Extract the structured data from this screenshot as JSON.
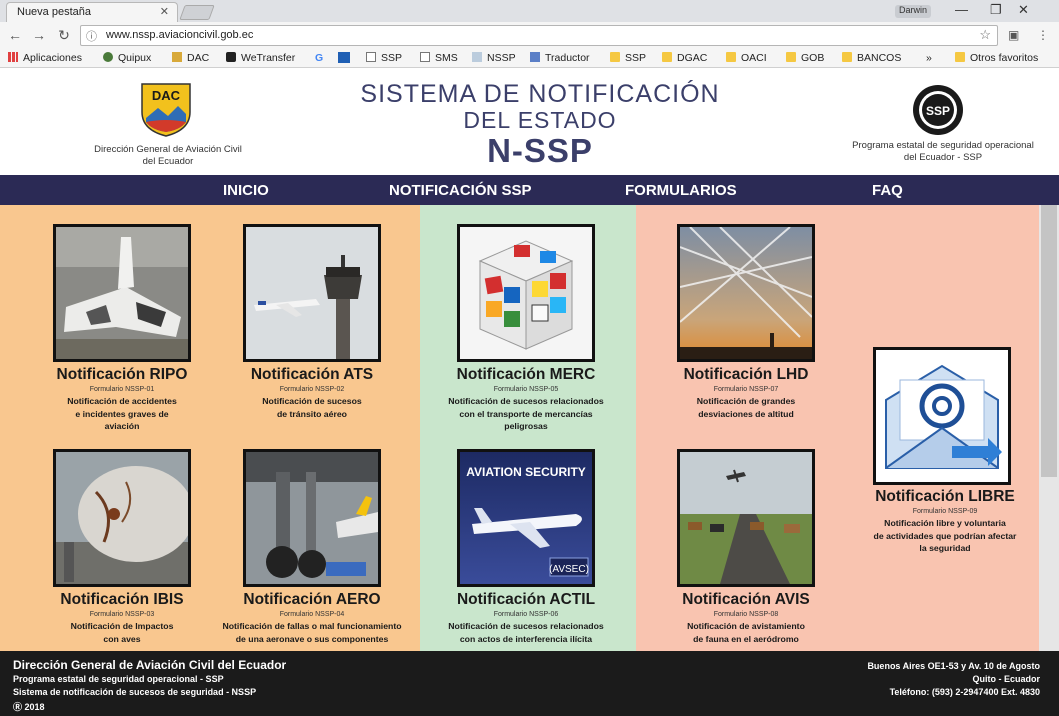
{
  "browser": {
    "tab_title": "Nueva pestaña",
    "user_name": "Darwin",
    "url": "www.nssp.aviacioncivil.gob.ec",
    "bookmarks": [
      "Aplicaciones",
      "Quipux",
      "DAC",
      "WeTransfer",
      "G",
      "SSP",
      "SMS",
      "NSSP",
      "Traductor",
      "SSP",
      "DGAC",
      "OACI",
      "GOB",
      "BANCOS"
    ],
    "overflow": "»",
    "other_bookmarks": "Otros favoritos"
  },
  "header": {
    "dac_logo_text": "DAC",
    "dac_caption_line1": "Dirección General de Aviación Civil",
    "dac_caption_line2": "del Ecuador",
    "title_line1": "SISTEMA DE NOTIFICACIÓN",
    "title_line2": "DEL ESTADO",
    "title_line3": "N-SSP",
    "ssp_logo_text": "SSP",
    "ssp_caption_line1": "Programa estatal de seguridad operacional",
    "ssp_caption_line2": "del Ecuador - SSP"
  },
  "nav": {
    "items": [
      "INICIO",
      "NOTIFICACIÓN SSP",
      "FORMULARIOS",
      "FAQ"
    ]
  },
  "cards": [
    {
      "title": "Notificación RIPO",
      "form": "Formulario NSSP-01",
      "desc": "Notificación de accidentes\ne incidentes graves de\naviación",
      "image": "crashed-airplane-photo"
    },
    {
      "title": "Notificación ATS",
      "form": "Formulario NSSP-02",
      "desc": "Notificación de sucesos\nde tránsito aéreo",
      "image": "control-tower-photo"
    },
    {
      "title": "Notificación MERC",
      "form": "Formulario NSSP-05",
      "desc": "Notificación de sucesos relacionados\ncon el transporte de mercancías\npeligrosas",
      "image": "hazard-cube-image"
    },
    {
      "title": "Notificación LHD",
      "form": "Formulario NSSP-07",
      "desc": "Notificación de grandes\ndesviaciones de altitud",
      "image": "contrails-sky-photo"
    },
    {
      "title": "Notificación IBIS",
      "form": "Formulario NSSP-03",
      "desc": "Notificación de Impactos\ncon aves",
      "image": "bird-strike-nose-photo"
    },
    {
      "title": "Notificación AERO",
      "form": "Formulario NSSP-04",
      "desc": "Notificación de fallas o mal funcionamiento\nde una aeronave o sus componentes",
      "image": "landing-gear-photo"
    },
    {
      "title": "Notificación ACTIL",
      "form": "Formulario NSSP-06",
      "desc": "Notificación de sucesos relacionados\ncon actos de interferencia ilícita",
      "image": "aviation-security-image",
      "image_text_top": "AVIATION SECURITY",
      "image_text_bottom": "(AVSEC)"
    },
    {
      "title": "Notificación AVIS",
      "form": "Formulario NSSP-08",
      "desc": "Notificación de avistamiento\nde fauna en el aeródromo",
      "image": "cattle-runway-photo"
    },
    {
      "title": "Notificación LIBRE",
      "form": "Formulario NSSP-09",
      "desc": "Notificación libre y voluntaria\nde actividades que podrían afectar\nla seguridad",
      "image": "email-envelope-icon"
    }
  ],
  "footer": {
    "line1": "Dirección General de Aviación Civil del Ecuador",
    "line2": "Programa estatal de seguridad operacional - SSP",
    "line3": "Sistema de notificación de sucesos de seguridad - NSSP",
    "line4": "Ⓡ 2018",
    "address1": "Buenos Aires OE1-53 y Av. 10 de Agosto",
    "address2": "Quito - Ecuador",
    "phone": "Teléfono:  (593) 2-2947400   Ext. 4830"
  },
  "colors": {
    "nav_bg": "#2b2a55",
    "title": "#3b3f6a",
    "col_orange": "#f9c78f",
    "col_green": "#c9e6cc",
    "col_salmon": "#f9c4b0",
    "footer_bg": "#1b1b1b"
  }
}
